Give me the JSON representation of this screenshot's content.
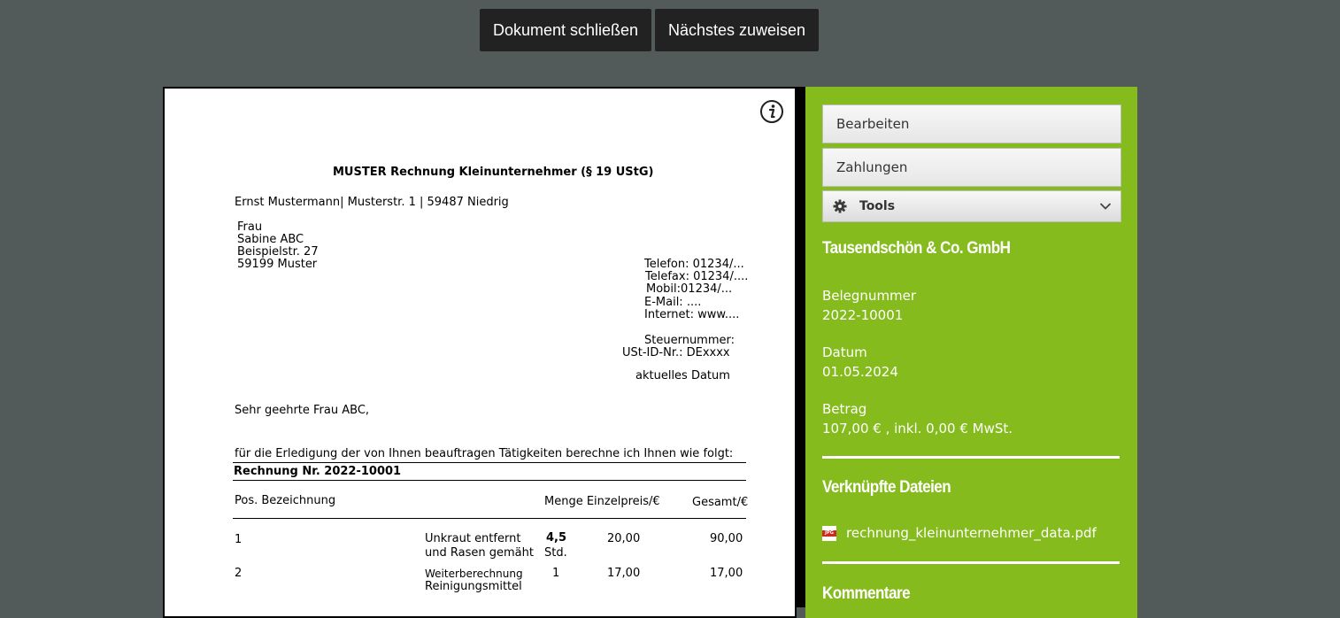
{
  "top": {
    "close_label": "Dokument schließen",
    "next_label": "Nächstes zuweisen"
  },
  "document": {
    "title": "MUSTER Rechnung Kleinunternehmer (§ 19 UStG)",
    "sender_line": "Ernst Mustermann| Musterstr. 1 | 59487 Niedrig",
    "recipient": [
      "Frau",
      "Sabine ABC",
      "Beispielstr. 27",
      "59199 Muster"
    ],
    "contact": [
      "Telefon:  01234/...",
      "Telefax:  01234/....",
      "Mobil:01234/...",
      "E-Mail: ....",
      "Internet: www...."
    ],
    "tax_number": "Steuernummer:",
    "vat_id": "USt-ID-Nr.: DExxxx",
    "date": "aktuelles Datum",
    "salutation": "Sehr geehrte Frau ABC,",
    "intro": "für die Erledigung der von Ihnen beauftragen Tätigkeiten berechne ich Ihnen wie folgt:",
    "invoice_number": "Rechnung Nr. 2022-10001",
    "table": {
      "headers": {
        "pos": "Pos. Bezeichnung",
        "qty_price": "Menge Einzelpreis/€",
        "total": "Gesamt/€"
      },
      "rows": [
        {
          "pos": "1",
          "desc1": "Unkraut entfernt",
          "desc2": "und Rasen gemäht",
          "qty": "4,5",
          "unit": "Std.",
          "price": "20,00",
          "total": "90,00"
        },
        {
          "pos": "2",
          "desc1": "Weiterberechnung",
          "desc2": "Reinigungsmittel",
          "qty": "1",
          "unit": "",
          "price": "17,00",
          "total": "17,00"
        }
      ]
    }
  },
  "panel": {
    "edit_label": "Bearbeiten",
    "payments_label": "Zahlungen",
    "tools_label": "Tools",
    "company": "Tausendschön & Co. GmbH",
    "receipt_label": "Belegnummer",
    "receipt_value": "2022-10001",
    "date_label": "Datum",
    "date_value": "01.05.2024",
    "amount_label": "Betrag",
    "amount_value": "107,00 € , inkl. 0,00 € MwSt.",
    "linked_files_title": "Verknüpfte Dateien",
    "file_icon_text": "JPG",
    "file_name": "rechnung_kleinunternehmer_data.pdf",
    "comments_title": "Kommentare"
  }
}
